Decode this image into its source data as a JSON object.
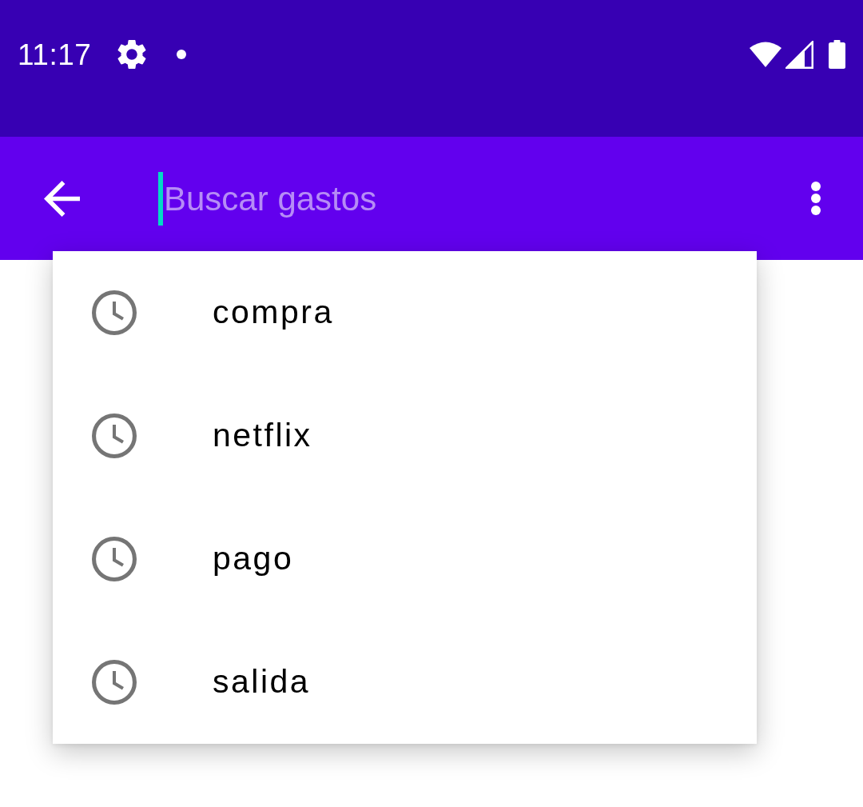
{
  "status_bar": {
    "time": "11:17"
  },
  "search": {
    "placeholder": "Buscar gastos",
    "focused": true
  },
  "suggestions": [
    {
      "text": "compra"
    },
    {
      "text": "netflix"
    },
    {
      "text": "pago"
    },
    {
      "text": "salida"
    }
  ]
}
